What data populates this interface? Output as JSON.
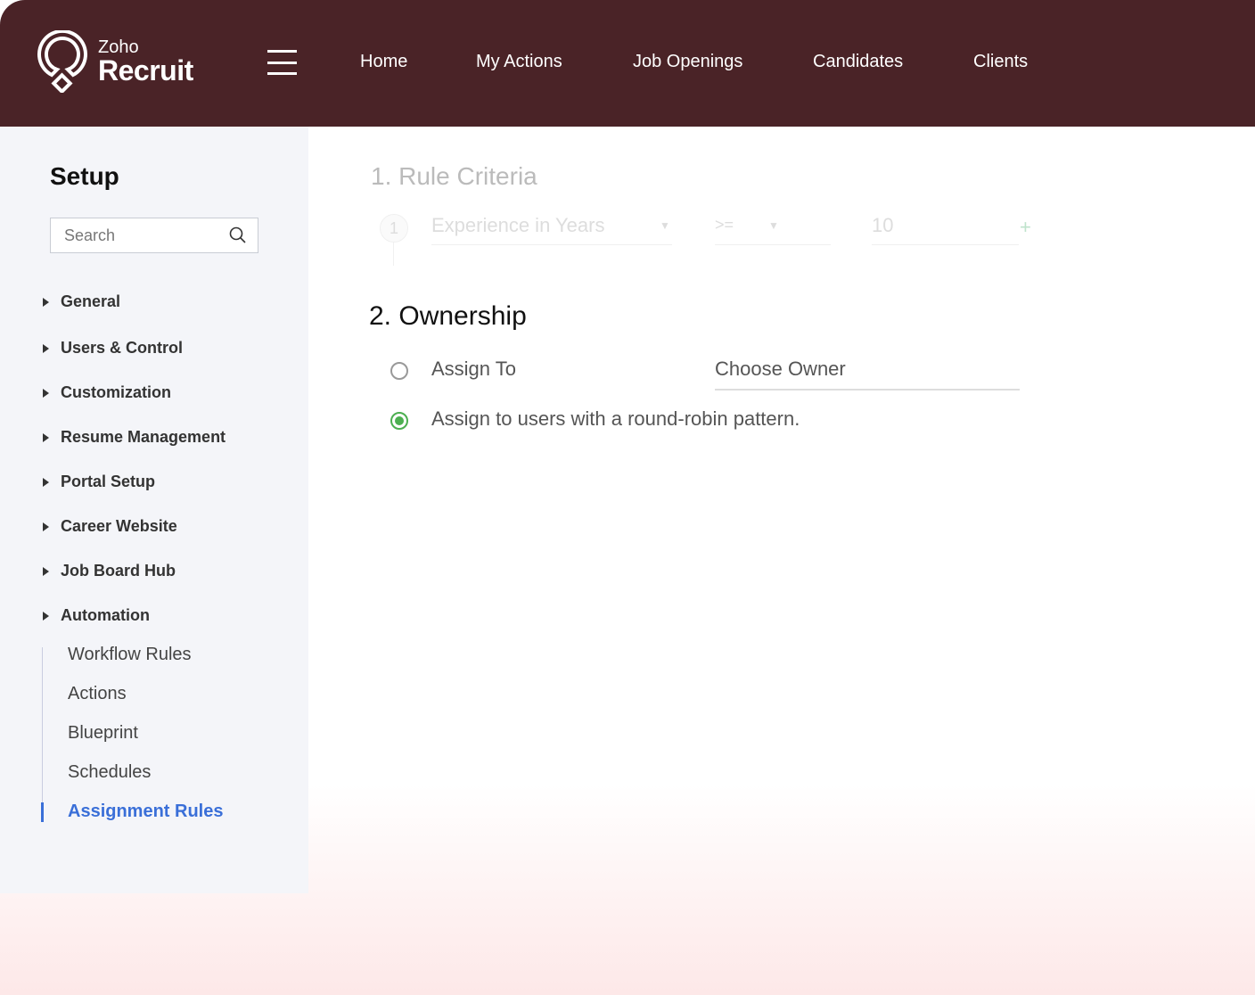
{
  "brand": {
    "zoho": "Zoho",
    "recruit": "Recruit"
  },
  "nav": [
    {
      "label": "Home"
    },
    {
      "label": "My Actions"
    },
    {
      "label": "Job Openings"
    },
    {
      "label": "Candidates"
    },
    {
      "label": "Clients"
    }
  ],
  "sidebar": {
    "title": "Setup",
    "search_placeholder": "Search",
    "sections": [
      {
        "label": "General"
      },
      {
        "label": "Users & Control"
      },
      {
        "label": "Customization"
      },
      {
        "label": "Resume Management"
      },
      {
        "label": "Portal Setup"
      },
      {
        "label": "Career Website"
      },
      {
        "label": "Job Board Hub"
      },
      {
        "label": "Automation"
      }
    ],
    "automation_items": [
      {
        "label": "Workflow Rules"
      },
      {
        "label": "Actions"
      },
      {
        "label": "Blueprint"
      },
      {
        "label": "Schedules"
      },
      {
        "label": "Assignment Rules"
      }
    ]
  },
  "criteria": {
    "title": "1. Rule Criteria",
    "row_number": "1",
    "field": "Experience in Years",
    "operator": ">=",
    "value": "10",
    "add": "+"
  },
  "ownership": {
    "title": "2. Ownership",
    "option1": "Assign To",
    "owner_placeholder": "Choose Owner",
    "option2": "Assign to users with a round-robin pattern.",
    "selected": "option2"
  },
  "colors": {
    "header": "#4a2327",
    "accent": "#3a6fd8",
    "radio": "#4caf50"
  }
}
